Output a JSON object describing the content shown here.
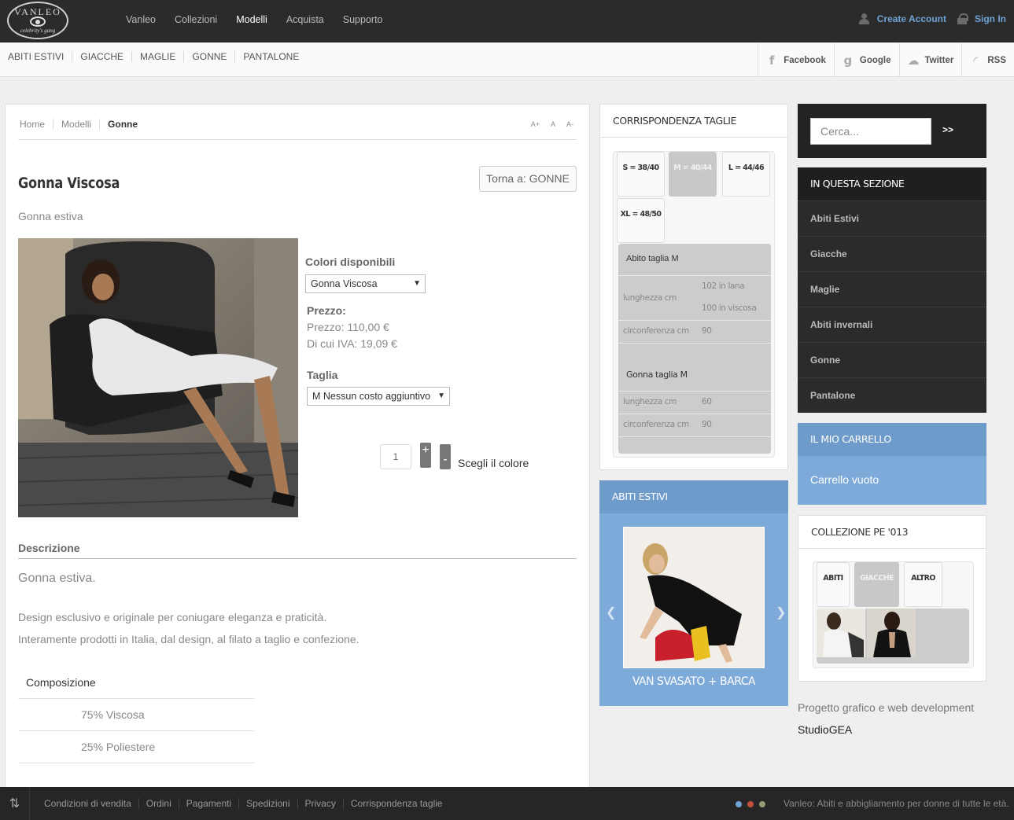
{
  "header": {
    "logo": {
      "text": "VANLEO",
      "tagline": "celebrity's gang"
    },
    "nav": [
      "Vanleo",
      "Collezioni",
      "Modelli",
      "Acquista",
      "Supporto"
    ],
    "nav_active": "Modelli",
    "create_account": "Create Account",
    "sign_in": "Sign In"
  },
  "subbar": {
    "categories": [
      "ABITI ESTIVI",
      "GIACCHE",
      "MAGLIE",
      "GONNE",
      "PANTALONE"
    ],
    "social": [
      {
        "label": "Facebook",
        "icon": "facebook-icon"
      },
      {
        "label": "Google",
        "icon": "google-icon"
      },
      {
        "label": "Twitter",
        "icon": "twitter-icon"
      },
      {
        "label": "RSS",
        "icon": "rss-icon"
      }
    ]
  },
  "breadcrumb": [
    "Home",
    "Modelli",
    "Gonne"
  ],
  "font_size_controls": [
    "A+",
    "A",
    "A-"
  ],
  "product": {
    "title": "Gonna Viscosa",
    "back_button": "Torna a: GONNE",
    "subtitle": "Gonna estiva",
    "colors_label": "Colori disponibili",
    "color_selected": "Gonna Viscosa",
    "price_label": "Prezzo:",
    "price": "Prezzo: 110,00 €",
    "vat": "Di cui IVA: 19,09 €",
    "size_label": "Taglia",
    "size_selected": "M Nessun costo aggiuntivo",
    "quantity": "1",
    "plus": "+",
    "minus": "-",
    "add_button": "Scegli il colore"
  },
  "description": {
    "heading": "Descrizione",
    "lead": "Gonna estiva.",
    "p1": "Design esclusivo e originale per coniugare eleganza e praticità.",
    "p2": "Interamente prodotti in Italia, dal design, al filato a taglio e confezione.",
    "composition_header": "Composizione",
    "composition": [
      "75% Viscosa",
      "25% Poliestere"
    ]
  },
  "size_chart": {
    "title": "CORRISPONDENZA TAGLIE",
    "tabs": [
      "S = 38/40",
      "M = 40/44",
      "L = 44/46",
      "XL = 48/50"
    ],
    "active_tab": "M = 40/44",
    "dress_title": "Abito taglia M",
    "dress_length_label": "lunghezza cm",
    "dress_length_wool": "102 in lana",
    "dress_length_viscose": "100 in viscosa",
    "dress_circ_label": "circonferenza cm",
    "dress_circ": "90",
    "skirt_title": "Gonna taglia M",
    "skirt_length_label": "lunghezza cm",
    "skirt_length": "60",
    "skirt_circ_label": "circonferenza cm",
    "skirt_circ": "90"
  },
  "carousel": {
    "title": "ABITI ESTIVI",
    "caption": "VAN SVASATO + BARCA"
  },
  "search": {
    "placeholder": "Cerca...",
    "button": ">>"
  },
  "section": {
    "title": "IN QUESTA SEZIONE",
    "items": [
      "Abiti Estivi",
      "Giacche",
      "Maglie",
      "Abiti invernali",
      "Gonne",
      "Pantalone"
    ]
  },
  "cart": {
    "title": "IL MIO CARRELLO",
    "empty": "Carrello vuoto"
  },
  "collection": {
    "title": "COLLEZIONE PE '013",
    "tabs": [
      "ABITI",
      "GIACCHE",
      "ALTRO"
    ],
    "active_tab": "GIACCHE"
  },
  "credits": {
    "line1": "Progetto grafico e web development",
    "line2": "StudioGEA"
  },
  "footer": {
    "links": [
      "Condizioni di vendita",
      "Ordini",
      "Pagamenti",
      "Spedizioni",
      "Privacy",
      "Corrispondenza taglie"
    ],
    "tagline": "Vanleo: Abiti e abbigliamento per donne di tutte le età.",
    "dot_colors": [
      "#6fa3d6",
      "#c0503a",
      "#9a9a78"
    ]
  }
}
